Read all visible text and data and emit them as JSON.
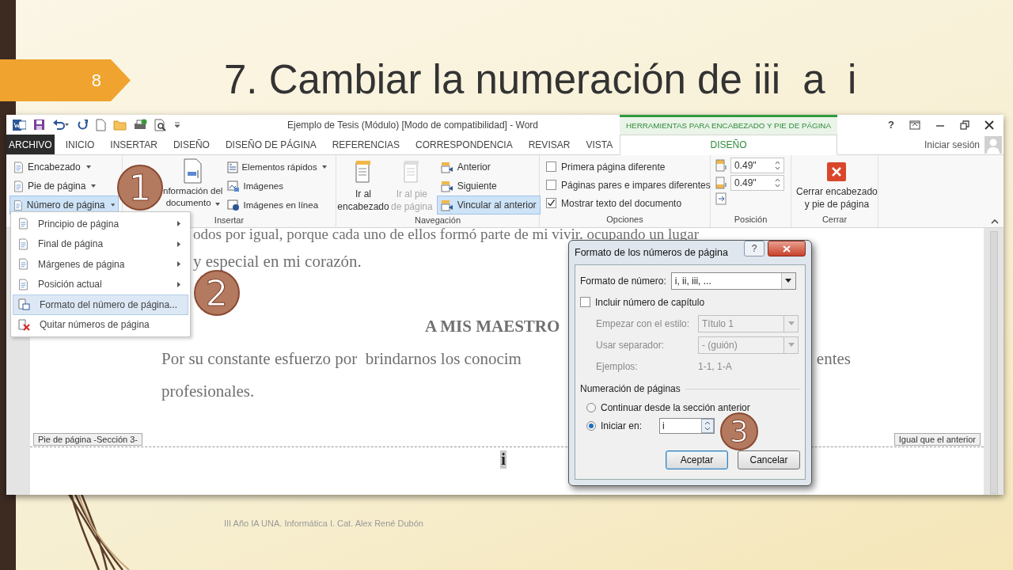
{
  "slide": {
    "number": "8",
    "title": "7. Cambiar la numeración de iii  a  i",
    "footer": "III Año IA UNA. Informática I. Cat. Alex René Dubón"
  },
  "window": {
    "title": "Ejemplo de Tesis (Módulo) [Modo de compatibilidad] - Word",
    "contextual_group": "HERRAMIENTAS PARA ENCABEZADO Y PIE DE PÁGINA",
    "help": "?",
    "account": "Iniciar sesión"
  },
  "tabs": [
    {
      "label": "ARCHIVO",
      "kind": "file",
      "selected": false
    },
    {
      "label": "INICIO",
      "kind": "normal",
      "selected": false
    },
    {
      "label": "INSERTAR",
      "kind": "normal",
      "selected": false
    },
    {
      "label": "DISEÑO",
      "kind": "normal",
      "selected": false
    },
    {
      "label": "DISEÑO DE PÁGINA",
      "kind": "normal",
      "selected": false
    },
    {
      "label": "REFERENCIAS",
      "kind": "normal",
      "selected": false
    },
    {
      "label": "CORRESPONDENCIA",
      "kind": "normal",
      "selected": false
    },
    {
      "label": "REVISAR",
      "kind": "normal",
      "selected": false
    },
    {
      "label": "VISTA",
      "kind": "normal",
      "selected": false
    },
    {
      "label": "DISEÑO",
      "kind": "contextual",
      "selected": true
    }
  ],
  "ribbon": {
    "header_footer": [
      {
        "label": "Encabezado",
        "selected": false
      },
      {
        "label": "Pie de página",
        "selected": false
      },
      {
        "label": "Número de página",
        "selected": true
      }
    ],
    "insert": {
      "label": "Insertar",
      "document_info": [
        "nformación del",
        "documento"
      ],
      "small": [
        "Elementos rápidos",
        "Imágenes",
        "Imágenes en línea"
      ]
    },
    "navigation": {
      "label": "Navegación",
      "large": [
        {
          "lines": [
            "Ir al",
            "encabezado"
          ],
          "disabled": false
        },
        {
          "lines": [
            "Ir al pie",
            "de página"
          ],
          "disabled": true
        }
      ],
      "small": [
        {
          "label": "Anterior",
          "selected": false
        },
        {
          "label": "Siguiente",
          "selected": false
        },
        {
          "label": "Vincular al anterior",
          "selected": true
        }
      ]
    },
    "options": {
      "label": "Opciones",
      "checkboxes": [
        {
          "label": "Primera página diferente",
          "checked": false
        },
        {
          "label": "Páginas pares e impares diferentes",
          "checked": false
        },
        {
          "label": "Mostrar texto del documento",
          "checked": true
        }
      ]
    },
    "position": {
      "label": "Posición",
      "spinners": [
        "0.49\"",
        "0.49\""
      ]
    },
    "close": {
      "label": "Cerrar",
      "lines": [
        "Cerrar encabezado",
        "y pie de página"
      ]
    }
  },
  "document": {
    "lines": [
      "odos por igual, porque cada uno de ellos formó parte de mi vivir. ocupando un lugar",
      "y especial en mi corazón."
    ],
    "heading": "A MIS MAESTRO",
    "paragraph_left": "Por su constante esfuerzo por  brindarnos los conocim",
    "paragraph_right": "entes",
    "last_line": "profesionales.",
    "footer_label": "Pie de página -Sección 3-",
    "link_label": "Igual que el anterior",
    "page_number": "i"
  },
  "menu": [
    {
      "label": "Principio de página",
      "kind": "page",
      "submenu": true,
      "selected": false
    },
    {
      "label": "Final de página",
      "kind": "page",
      "submenu": true,
      "selected": false
    },
    {
      "label": "Márgenes de página",
      "kind": "page",
      "submenu": true,
      "selected": false
    },
    {
      "label": "Posición actual",
      "kind": "page",
      "submenu": true,
      "selected": false
    },
    {
      "label": "Formato del número de página...",
      "kind": "format",
      "submenu": false,
      "selected": true
    },
    {
      "label": "Quitar números de página",
      "kind": "remove",
      "submenu": false,
      "selected": false
    }
  ],
  "dialog": {
    "title": "Formato de los números de página",
    "help": "?",
    "number_format": {
      "label": "Formato de número:",
      "value": "i, ii, iii, ..."
    },
    "include_chapter": {
      "label": "Incluir número de capítulo",
      "checked": false
    },
    "start_style": {
      "label": "Empezar con el estilo:",
      "value": "Título 1",
      "disabled": true
    },
    "separator": {
      "label": "Usar separador:",
      "value": "-    (guión)",
      "disabled": true
    },
    "examples": {
      "label": "Ejemplos:",
      "value": "1-1, 1-A"
    },
    "section": "Numeración de páginas",
    "radios": [
      {
        "label": "Continuar desde la sección anterior",
        "selected": false
      },
      {
        "label": "Iniciar en:",
        "selected": true
      }
    ],
    "start_at": "i",
    "buttons": [
      "Aceptar",
      "Cancelar"
    ]
  },
  "callouts": [
    "1",
    "2",
    "3"
  ]
}
